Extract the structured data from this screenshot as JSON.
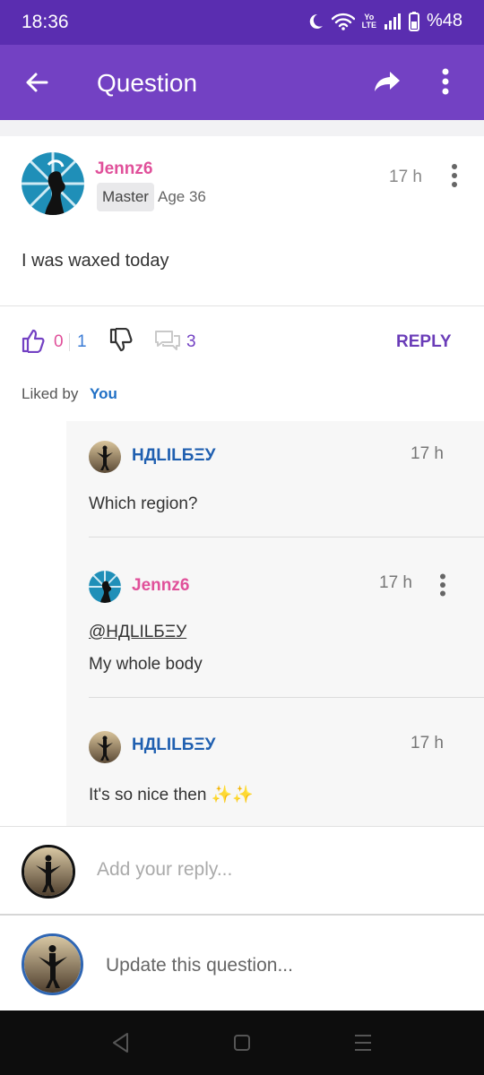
{
  "status": {
    "time": "18:36",
    "volte_line1": "Yo",
    "volte_line2": "LTE",
    "battery": "%48",
    "icons": [
      "moon-icon",
      "wifi-icon",
      "signal-icon",
      "battery-icon"
    ]
  },
  "header": {
    "title": "Question",
    "icons": [
      "back-arrow-icon",
      "share-icon",
      "more-vertical-icon"
    ]
  },
  "question": {
    "author": "Jennz6",
    "rank": "Master",
    "age": "Age 36",
    "time": "17 h",
    "text": "I was waxed today"
  },
  "actions": {
    "likes": "0",
    "dislikes": "1",
    "comments": "3",
    "reply_label": "REPLY",
    "liked_by_label": "Liked by",
    "liked_by_name": "You"
  },
  "replies": [
    {
      "author": "НДLILБΞУ",
      "time": "17 h",
      "text": "Which region?"
    },
    {
      "author": "Jennz6",
      "time": "17 h",
      "mention": "@НДLILБΞУ",
      "text": "My whole body"
    },
    {
      "author": "НДLILБΞУ",
      "time": "17 h",
      "text": "It's so nice then ✨✨"
    }
  ],
  "reply_box": {
    "placeholder": "Add your reply..."
  },
  "update": {
    "text": "Update this question..."
  },
  "colors": {
    "status_bar": "#5a2db0",
    "app_bar": "#7341c3",
    "author_pink": "#e0509a",
    "author_blue": "#1f5fb0"
  }
}
